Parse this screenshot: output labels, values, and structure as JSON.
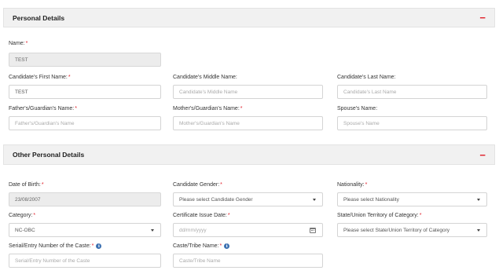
{
  "personal": {
    "title": "Personal Details",
    "collapse": "−",
    "name_label": "Name:",
    "name_value": "TEST",
    "first_name_label": "Candidate's First Name:",
    "first_name_value": "TEST",
    "middle_name_label": "Candidate's Middle Name:",
    "middle_name_placeholder": "Candidate's Middle Name",
    "last_name_label": "Candidate's Last Name:",
    "last_name_placeholder": "Candidate's Last Name",
    "father_label": "Father's/Guardian's Name:",
    "father_placeholder": "Father's/Guardian's Name",
    "mother_label": "Mother's/Guardian's Name:",
    "mother_placeholder": "Mother's/Guardian's Name",
    "spouse_label": "Spouse's Name:",
    "spouse_placeholder": "Spouse's Name"
  },
  "other": {
    "title": "Other Personal Details",
    "collapse": "−",
    "dob_label": "Date of Birth:",
    "dob_value": "23/08/2007",
    "gender_label": "Candidate Gender:",
    "gender_value": "Please select Candidate Gender",
    "nationality_label": "Nationality:",
    "nationality_value": "Please select Nationality",
    "category_label": "Category:",
    "category_value": "NC-OBC",
    "cert_date_label": "Certificate Issue Date:",
    "cert_date_placeholder": "dd/mm/yyyy",
    "state_label": "State/Union Territory of Category:",
    "state_value": "Please select State/Union Territory of Category",
    "serial_label": "Serial/Entry Number of the Caste:",
    "serial_placeholder": "Serial/Entry Number of the Caste",
    "caste_label": "Caste/Tribe Name:",
    "caste_placeholder": "Caste/Tribe Name"
  },
  "required_mark": "*",
  "icons": {
    "info": "info-icon",
    "calendar": "calendar-icon",
    "dropdown": "chevron-down-icon"
  },
  "colors": {
    "required": "#e0202a",
    "header_bg": "#f1f1f1",
    "info": "#3a6fb0"
  }
}
